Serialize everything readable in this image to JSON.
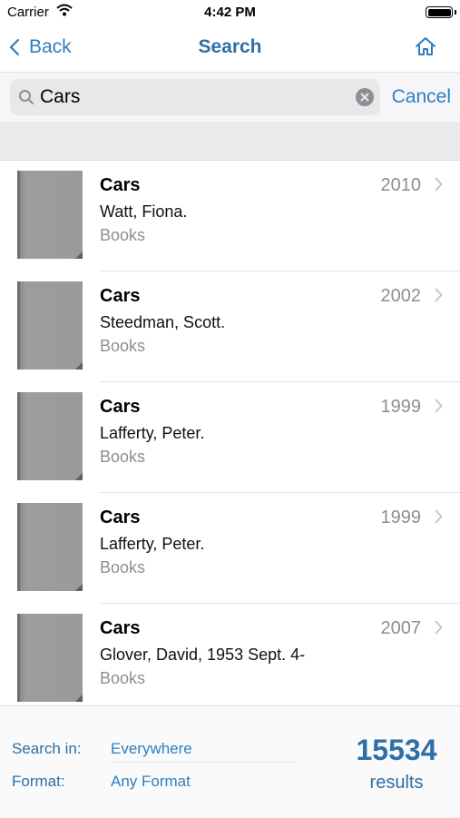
{
  "status_bar": {
    "carrier": "Carrier",
    "time": "4:42 PM"
  },
  "nav": {
    "back_label": "Back",
    "title": "Search"
  },
  "search": {
    "query": "Cars",
    "cancel_label": "Cancel"
  },
  "results": [
    {
      "title": "Cars",
      "author": "Watt, Fiona.",
      "format": "Books",
      "year": "2010"
    },
    {
      "title": "Cars",
      "author": "Steedman, Scott.",
      "format": "Books",
      "year": "2002"
    },
    {
      "title": "Cars",
      "author": "Lafferty, Peter.",
      "format": "Books",
      "year": "1999"
    },
    {
      "title": "Cars",
      "author": "Lafferty, Peter.",
      "format": "Books",
      "year": "1999"
    },
    {
      "title": "Cars",
      "author": "Glover, David, 1953 Sept. 4-",
      "format": "Books",
      "year": "2007"
    }
  ],
  "footer": {
    "search_in_label": "Search in:",
    "search_in_value": "Everywhere",
    "format_label": "Format:",
    "format_value": "Any Format",
    "result_count": "15534",
    "results_label": "results"
  },
  "colors": {
    "accent": "#2f7ec1",
    "title_blue": "#2f6ea6",
    "secondary_text": "#8e8e93"
  }
}
